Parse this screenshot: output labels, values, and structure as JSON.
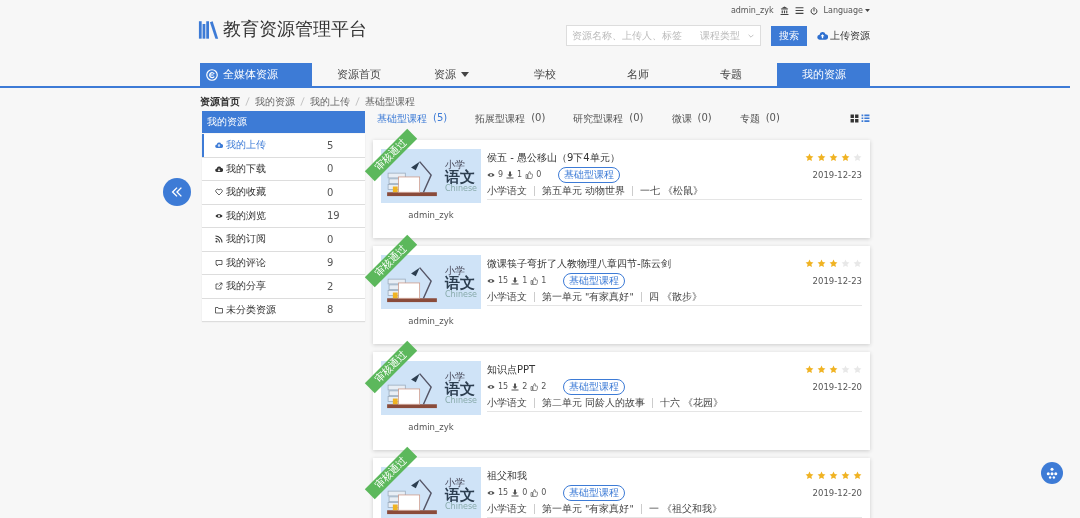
{
  "header": {
    "title": "教育资源管理平台",
    "user": "admin_zyk",
    "language": "Language",
    "search": {
      "placeholder": "资源名称、上传人、标签",
      "type_placeholder": "课程类型",
      "button": "搜索"
    },
    "upload": "上传资源"
  },
  "nav": [
    {
      "label": "全媒体资源",
      "kind": "brand",
      "selected": true
    },
    {
      "label": "资源首页",
      "kind": "link",
      "selected": false
    },
    {
      "label": "资源",
      "kind": "dropdown",
      "selected": false
    },
    {
      "label": "学校",
      "kind": "link",
      "selected": false
    },
    {
      "label": "名师",
      "kind": "link",
      "selected": false
    },
    {
      "label": "专题",
      "kind": "link",
      "selected": false
    },
    {
      "label": "我的资源",
      "kind": "link",
      "selected": true
    }
  ],
  "breadcrumb": [
    "资源首页",
    "我的资源",
    "我的上传",
    "基础型课程"
  ],
  "sidebar": {
    "title": "我的资源",
    "items": [
      {
        "label": "我的上传",
        "count": "5",
        "kind": "upload",
        "selected": true
      },
      {
        "label": "我的下载",
        "count": "0",
        "kind": "download",
        "selected": false
      },
      {
        "label": "我的收藏",
        "count": "0",
        "kind": "favorite",
        "selected": false
      },
      {
        "label": "我的浏览",
        "count": "19",
        "kind": "history",
        "selected": false
      },
      {
        "label": "我的订阅",
        "count": "0",
        "kind": "subscription",
        "selected": false
      },
      {
        "label": "我的评论",
        "count": "9",
        "kind": "comment",
        "selected": false
      },
      {
        "label": "我的分享",
        "count": "2",
        "kind": "share",
        "selected": false
      },
      {
        "label": "未分类资源",
        "count": "8",
        "kind": "unsorted",
        "selected": false
      }
    ]
  },
  "tabs": [
    {
      "label": "基础型课程",
      "count": "(5)",
      "selected": true
    },
    {
      "label": "拓展型课程",
      "count": "(0)",
      "selected": false
    },
    {
      "label": "研究型课程",
      "count": "(0)",
      "selected": false
    },
    {
      "label": "微课",
      "count": "(0)",
      "selected": false
    },
    {
      "label": "专题",
      "count": "(0)",
      "selected": false
    }
  ],
  "view_modes": [
    {
      "kind": "grid",
      "selected": false
    },
    {
      "kind": "list",
      "selected": true
    }
  ],
  "cards": [
    {
      "status": "审核通过",
      "thumbnail": {
        "stage": "小学",
        "subject": "语文",
        "english": "Chinese"
      },
      "author": "admin_zyk",
      "title": "侯五 - 愚公移山（9下4单元）",
      "views": "9",
      "downloads": "1",
      "likes": "0",
      "tag": "基础型课程",
      "stars": 4,
      "date": "2019-12-23",
      "path": [
        "小学语文",
        "第五单元 动物世界",
        "一七 《松鼠》"
      ]
    },
    {
      "status": "审核通过",
      "thumbnail": {
        "stage": "小学",
        "subject": "语文",
        "english": "Chinese"
      },
      "author": "admin_zyk",
      "title": "微课筷子弯折了人教物理八章四节-陈云剑",
      "views": "15",
      "downloads": "1",
      "likes": "1",
      "tag": "基础型课程",
      "stars": 3,
      "date": "2019-12-23",
      "path": [
        "小学语文",
        "第一单元 \"有家真好\"",
        "四 《散步》"
      ]
    },
    {
      "status": "审核通过",
      "thumbnail": {
        "stage": "小学",
        "subject": "语文",
        "english": "Chinese"
      },
      "author": "admin_zyk",
      "title": "知识点PPT",
      "views": "15",
      "downloads": "2",
      "likes": "2",
      "tag": "基础型课程",
      "stars": 3,
      "date": "2019-12-20",
      "path": [
        "小学语文",
        "第二单元 同龄人的故事",
        "十六 《花园》"
      ]
    },
    {
      "status": "审核通过",
      "thumbnail": {
        "stage": "小学",
        "subject": "语文",
        "english": "Chinese"
      },
      "title": "祖父和我",
      "views": "15",
      "downloads": "0",
      "likes": "0",
      "tag": "基础型课程",
      "stars": 5,
      "date": "2019-12-20",
      "path": [
        "小学语文",
        "第一单元 \"有家真好\"",
        "一 《祖父和我》"
      ]
    }
  ]
}
